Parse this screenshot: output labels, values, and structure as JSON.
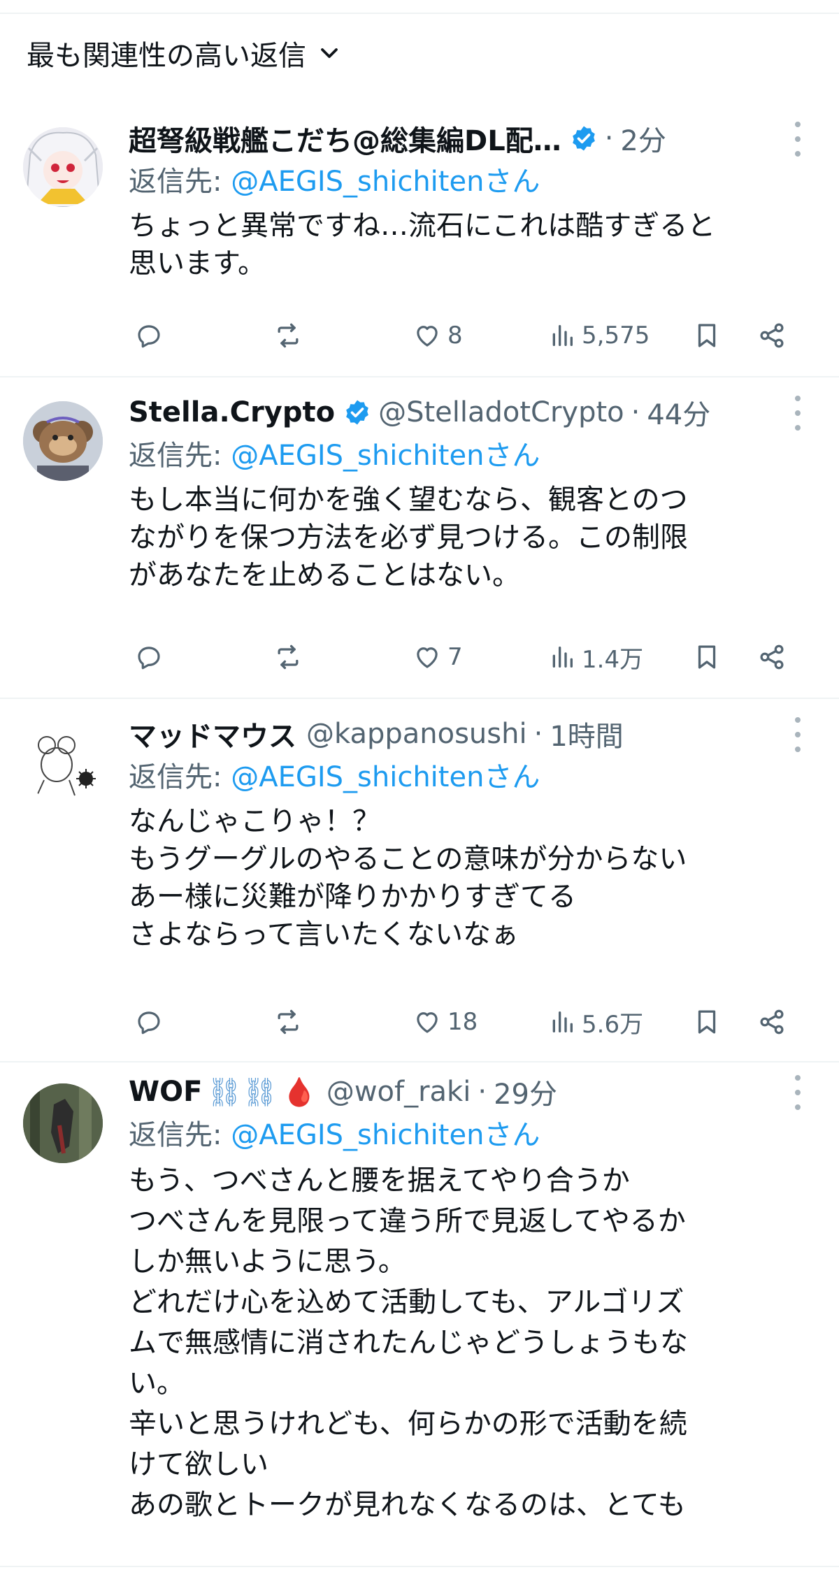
{
  "header": {
    "sort_label": "最も関連性の高い返信"
  },
  "tweets": [
    {
      "name": "超弩級戦艦こだち@総集編DL配…",
      "handle": "",
      "verified": true,
      "time": "2分",
      "reply_prefix": "返信先: ",
      "reply_handle": "@AEGIS_shichitenさん",
      "text": "ちょっと異常ですね…流石にこれは酷すぎると\n思います。",
      "likes": "8",
      "views": "5,575"
    },
    {
      "name": "Stella.Crypto",
      "handle": "@StelladotCrypto",
      "verified": true,
      "time": "44分",
      "reply_prefix": "返信先: ",
      "reply_handle": "@AEGIS_shichitenさん",
      "text": "もし本当に何かを強く望むなら、観客とのつ\nながりを保つ方法を必ず見つける。この制限\nがあなたを止めることはない。",
      "likes": "7",
      "views": "1.4万"
    },
    {
      "name": "マッドマウス",
      "handle": "@kappanosushi",
      "verified": false,
      "time": "1時間",
      "reply_prefix": "返信先: ",
      "reply_handle": "@AEGIS_shichitenさん",
      "text": "なんじゃこりゃ！？\nもうグーグルのやることの意味が分からない\nあー様に災難が降りかかりすぎてる\nさよならって言いたくないなぁ",
      "likes": "18",
      "views": "5.6万"
    },
    {
      "name": "WOF",
      "name_emoji": "⛓⛓",
      "name_drop": "🩸",
      "handle": "@wof_raki",
      "verified": false,
      "time": "29分",
      "reply_prefix": "返信先: ",
      "reply_handle": "@AEGIS_shichitenさん",
      "text": "もう、つべさんと腰を据えてやり合うか\nつべさんを見限って違う所で見返してやるか\nしか無いように思う。\nどれだけ心を込めて活動しても、アルゴリズ\nムで無感情に消されたんじゃどうしょうもな\nい。\n辛いと思うけれども、何らかの形で活動を続\nけて欲しい\nあの歌とトークが見れなくなるのは、とても"
    }
  ],
  "colors": {
    "accent": "#1d9bf0",
    "secondary_text": "#536471",
    "primary_text": "#0f1419",
    "divider": "#eff3f4"
  }
}
